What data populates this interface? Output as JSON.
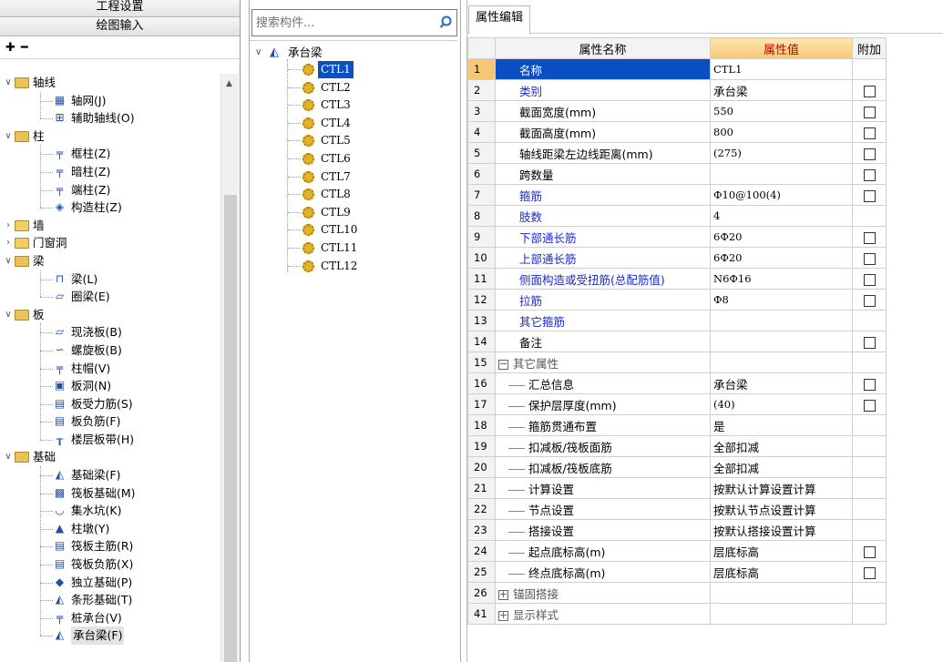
{
  "left": {
    "tabs": [
      "工程设置",
      "绘图输入"
    ],
    "toolbar": {
      "expand_icon": "expand-all-icon",
      "collapse_icon": "collapse-all-icon"
    },
    "tree": [
      {
        "label": "轴线",
        "level": 0,
        "type": "folder",
        "expanded": true
      },
      {
        "label": "轴网(J)",
        "level": 1,
        "icon": "grid-icon"
      },
      {
        "label": "辅助轴线(O)",
        "level": 1,
        "icon": "aux-axis-icon"
      },
      {
        "label": "柱",
        "level": 0,
        "type": "folder",
        "expanded": true
      },
      {
        "label": "框柱(Z)",
        "level": 1,
        "icon": "column-icon"
      },
      {
        "label": "暗柱(Z)",
        "level": 1,
        "icon": "hidden-column-icon"
      },
      {
        "label": "端柱(Z)",
        "level": 1,
        "icon": "end-column-icon"
      },
      {
        "label": "构造柱(Z)",
        "level": 1,
        "icon": "structural-column-icon"
      },
      {
        "label": "墙",
        "level": 0,
        "type": "folder",
        "expanded": false
      },
      {
        "label": "门窗洞",
        "level": 0,
        "type": "folder",
        "expanded": false
      },
      {
        "label": "梁",
        "level": 0,
        "type": "folder",
        "expanded": true
      },
      {
        "label": "梁(L)",
        "level": 1,
        "icon": "beam-icon"
      },
      {
        "label": "圈梁(E)",
        "level": 1,
        "icon": "ring-beam-icon"
      },
      {
        "label": "板",
        "level": 0,
        "type": "folder",
        "expanded": true
      },
      {
        "label": "现浇板(B)",
        "level": 1,
        "icon": "slab-icon"
      },
      {
        "label": "螺旋板(B)",
        "level": 1,
        "icon": "spiral-slab-icon"
      },
      {
        "label": "柱帽(V)",
        "level": 1,
        "icon": "column-cap-icon"
      },
      {
        "label": "板洞(N)",
        "level": 1,
        "icon": "slab-hole-icon"
      },
      {
        "label": "板受力筋(S)",
        "level": 1,
        "icon": "slab-rebar-icon"
      },
      {
        "label": "板负筋(F)",
        "level": 1,
        "icon": "slab-neg-rebar-icon"
      },
      {
        "label": "楼层板带(H)",
        "level": 1,
        "icon": "floor-strip-icon"
      },
      {
        "label": "基础",
        "level": 0,
        "type": "folder",
        "expanded": true
      },
      {
        "label": "基础梁(F)",
        "level": 1,
        "icon": "foundation-beam-icon"
      },
      {
        "label": "筏板基础(M)",
        "level": 1,
        "icon": "raft-foundation-icon"
      },
      {
        "label": "集水坑(K)",
        "level": 1,
        "icon": "sump-pit-icon"
      },
      {
        "label": "柱墩(Y)",
        "level": 1,
        "icon": "column-pier-icon"
      },
      {
        "label": "筏板主筋(R)",
        "level": 1,
        "icon": "raft-main-rebar-icon"
      },
      {
        "label": "筏板负筋(X)",
        "level": 1,
        "icon": "raft-neg-rebar-icon"
      },
      {
        "label": "独立基础(P)",
        "level": 1,
        "icon": "isolated-foundation-icon"
      },
      {
        "label": "条形基础(T)",
        "level": 1,
        "icon": "strip-foundation-icon"
      },
      {
        "label": "桩承台(V)",
        "level": 1,
        "icon": "pile-cap-icon"
      },
      {
        "label": "承台梁(F)",
        "level": 1,
        "icon": "cap-beam-icon",
        "selected": true
      }
    ]
  },
  "middle": {
    "search_placeholder": "搜索构件...",
    "root": "承台梁",
    "items": [
      "CTL1",
      "CTL2",
      "CTL3",
      "CTL4",
      "CTL5",
      "CTL6",
      "CTL7",
      "CTL8",
      "CTL9",
      "CTL10",
      "CTL11",
      "CTL12"
    ],
    "selected_index": 0
  },
  "right": {
    "tab": "属性编辑",
    "headers": {
      "name": "属性名称",
      "value": "属性值",
      "extra": "附加"
    },
    "rows": [
      {
        "num": "1",
        "name": "名称",
        "value": "CTL1",
        "color": "blue",
        "check": false,
        "selected": true
      },
      {
        "num": "2",
        "name": "类别",
        "value": "承台梁",
        "color": "blue",
        "check": true
      },
      {
        "num": "3",
        "name": "截面宽度(mm)",
        "value": "550",
        "color": "black",
        "check": true
      },
      {
        "num": "4",
        "name": "截面高度(mm)",
        "value": "800",
        "color": "black",
        "check": true
      },
      {
        "num": "5",
        "name": "轴线距梁左边线距离(mm)",
        "value": "(275)",
        "color": "black",
        "check": true
      },
      {
        "num": "6",
        "name": "跨数量",
        "value": "",
        "color": "black",
        "check": true
      },
      {
        "num": "7",
        "name": "箍筋",
        "value": "Ф10@100(4)",
        "color": "blue",
        "check": true
      },
      {
        "num": "8",
        "name": "肢数",
        "value": "4",
        "color": "blue",
        "check": false
      },
      {
        "num": "9",
        "name": "下部通长筋",
        "value": "6Ф20",
        "color": "blue",
        "check": true
      },
      {
        "num": "10",
        "name": "上部通长筋",
        "value": "6Ф20",
        "color": "blue",
        "check": true
      },
      {
        "num": "11",
        "name": "侧面构造或受扭筋(总配筋值)",
        "value": "N6Ф16",
        "color": "blue",
        "check": true
      },
      {
        "num": "12",
        "name": "拉筋",
        "value": "Ф8",
        "color": "blue",
        "check": true
      },
      {
        "num": "13",
        "name": "其它箍筋",
        "value": "",
        "color": "blue",
        "check": false
      },
      {
        "num": "14",
        "name": "备注",
        "value": "",
        "color": "black",
        "check": true
      },
      {
        "num": "15",
        "name": "其它属性",
        "value": "",
        "color": "gray",
        "group": "minus",
        "check": false
      },
      {
        "num": "16",
        "name": "汇总信息",
        "value": "承台梁",
        "color": "black",
        "child": true,
        "check": true
      },
      {
        "num": "17",
        "name": "保护层厚度(mm)",
        "value": "(40)",
        "color": "black",
        "child": true,
        "check": true
      },
      {
        "num": "18",
        "name": "箍筋贯通布置",
        "value": "是",
        "color": "black",
        "child": true,
        "check": false
      },
      {
        "num": "19",
        "name": "扣减板/筏板面筋",
        "value": "全部扣减",
        "color": "black",
        "child": true,
        "check": false
      },
      {
        "num": "20",
        "name": "扣减板/筏板底筋",
        "value": "全部扣减",
        "color": "black",
        "child": true,
        "check": false
      },
      {
        "num": "21",
        "name": "计算设置",
        "value": "按默认计算设置计算",
        "color": "black",
        "child": true,
        "check": false
      },
      {
        "num": "22",
        "name": "节点设置",
        "value": "按默认节点设置计算",
        "color": "black",
        "child": true,
        "check": false
      },
      {
        "num": "23",
        "name": "搭接设置",
        "value": "按默认搭接设置计算",
        "color": "black",
        "child": true,
        "check": false
      },
      {
        "num": "24",
        "name": "起点底标高(m)",
        "value": "层底标高",
        "color": "black",
        "child": true,
        "check": true
      },
      {
        "num": "25",
        "name": "终点底标高(m)",
        "value": "层底标高",
        "color": "black",
        "child": true,
        "check": true
      },
      {
        "num": "26",
        "name": "锚固搭接",
        "value": "",
        "color": "gray",
        "group": "plus",
        "check": false
      },
      {
        "num": "41",
        "name": "显示样式",
        "value": "",
        "color": "gray",
        "group": "plus",
        "check": false
      }
    ]
  }
}
